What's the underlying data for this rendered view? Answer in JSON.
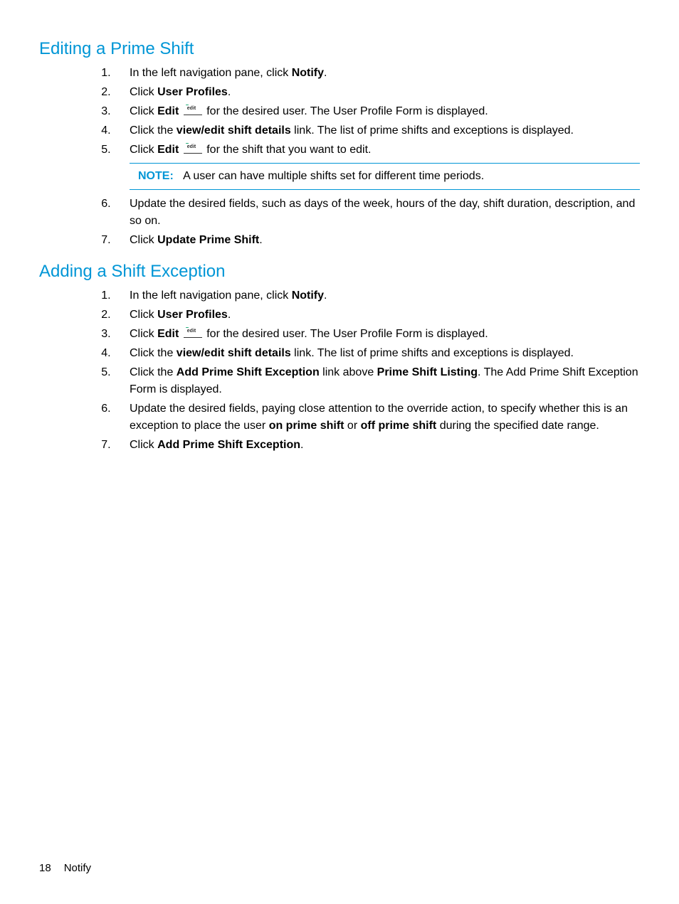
{
  "section1": {
    "heading": "Editing a Prime Shift",
    "steps": {
      "s1a": "In the left navigation pane, click ",
      "s1b": "Notify",
      "s1c": ".",
      "s2a": "Click ",
      "s2b": "User Profiles",
      "s2c": ".",
      "s3a": "Click ",
      "s3b": "Edit",
      "s3c": " for the desired user. The User Profile Form is displayed.",
      "s4a": "Click the ",
      "s4b": "view/edit shift details",
      "s4c": " link. The list of prime shifts and exceptions is displayed.",
      "s5a": "Click ",
      "s5b": "Edit",
      "s5c": " for the shift that you want to edit.",
      "note_label": "NOTE:",
      "note_text": "A user can have multiple shifts set for different time periods.",
      "s6": "Update the desired fields, such as days of the week, hours of the day, shift duration, description, and so on.",
      "s7a": "Click ",
      "s7b": "Update Prime Shift",
      "s7c": "."
    }
  },
  "section2": {
    "heading": "Adding a Shift Exception",
    "steps": {
      "s1a": "In the left navigation pane, click ",
      "s1b": "Notify",
      "s1c": ".",
      "s2a": "Click ",
      "s2b": "User Profiles",
      "s2c": ".",
      "s3a": "Click ",
      "s3b": "Edit",
      "s3c": " for the desired user. The User Profile Form is displayed.",
      "s4a": "Click the ",
      "s4b": "view/edit shift details",
      "s4c": " link. The list of prime shifts and exceptions is displayed.",
      "s5a": "Click the ",
      "s5b": "Add Prime Shift Exception",
      "s5c": " link above ",
      "s5d": "Prime Shift Listing",
      "s5e": ". The Add Prime Shift Exception Form is displayed.",
      "s6a": "Update the desired fields, paying close attention to the override action, to specify whether this is an exception to place the user ",
      "s6b": "on prime shift",
      "s6c": " or ",
      "s6d": "off prime shift",
      "s6e": " during the specified date range.",
      "s7a": "Click ",
      "s7b": "Add Prime Shift Exception",
      "s7c": "."
    }
  },
  "footer": {
    "page_number": "18",
    "section": "Notify"
  }
}
